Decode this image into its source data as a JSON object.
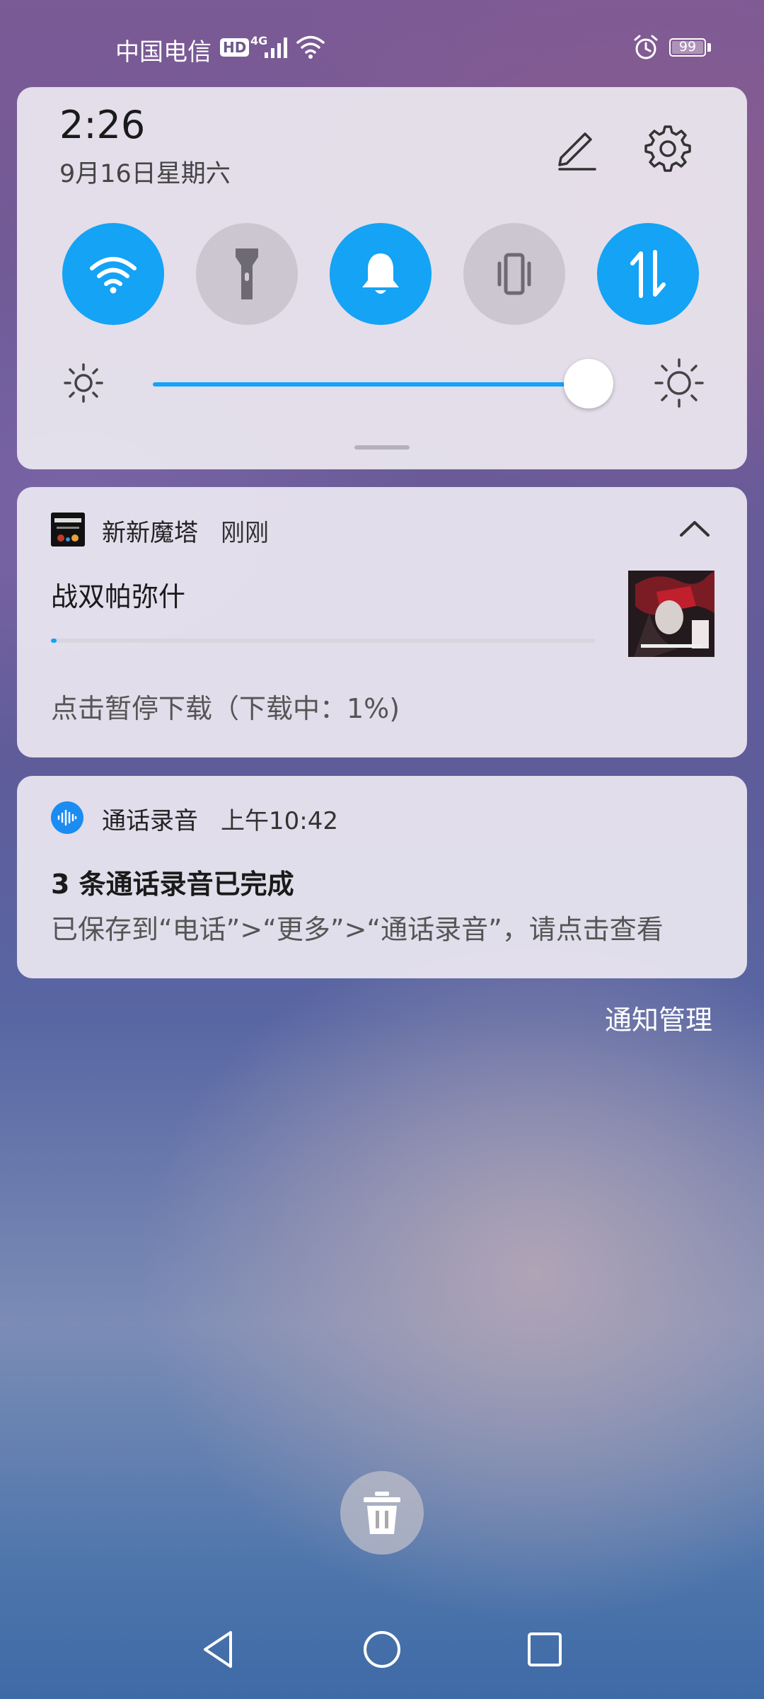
{
  "status_bar": {
    "carrier": "中国电信",
    "hd": "HD",
    "network": "4G",
    "battery_level": "99",
    "icons": [
      "hd-icon",
      "signal-icon",
      "wifi-icon",
      "alarm-icon",
      "battery-icon"
    ]
  },
  "quick_settings": {
    "time": "2:26",
    "date": "9月16日星期六",
    "tiles": [
      {
        "name": "wifi",
        "icon": "wifi-icon",
        "state": "on"
      },
      {
        "name": "flashlight",
        "icon": "flashlight-icon",
        "state": "off"
      },
      {
        "name": "sound",
        "icon": "bell-icon",
        "state": "on"
      },
      {
        "name": "vibrate",
        "icon": "vibrate-icon",
        "state": "off"
      },
      {
        "name": "mobile-data",
        "icon": "data-transfer-icon",
        "state": "on"
      }
    ],
    "brightness_level": 0.85,
    "accent_color": "#14a3f5"
  },
  "notifications": [
    {
      "app": "新新魔塔",
      "time": "刚刚",
      "title": "战双帕弥什",
      "progress": 0.01,
      "subtitle": "点击暂停下载（下载中：1%)"
    },
    {
      "app": "通话录音",
      "time": "上午10:42",
      "title": "3 条通话录音已完成",
      "body": "已保存到“电话”>“更多”>“通话录音”，请点击查看"
    }
  ],
  "manage_label": "通知管理"
}
